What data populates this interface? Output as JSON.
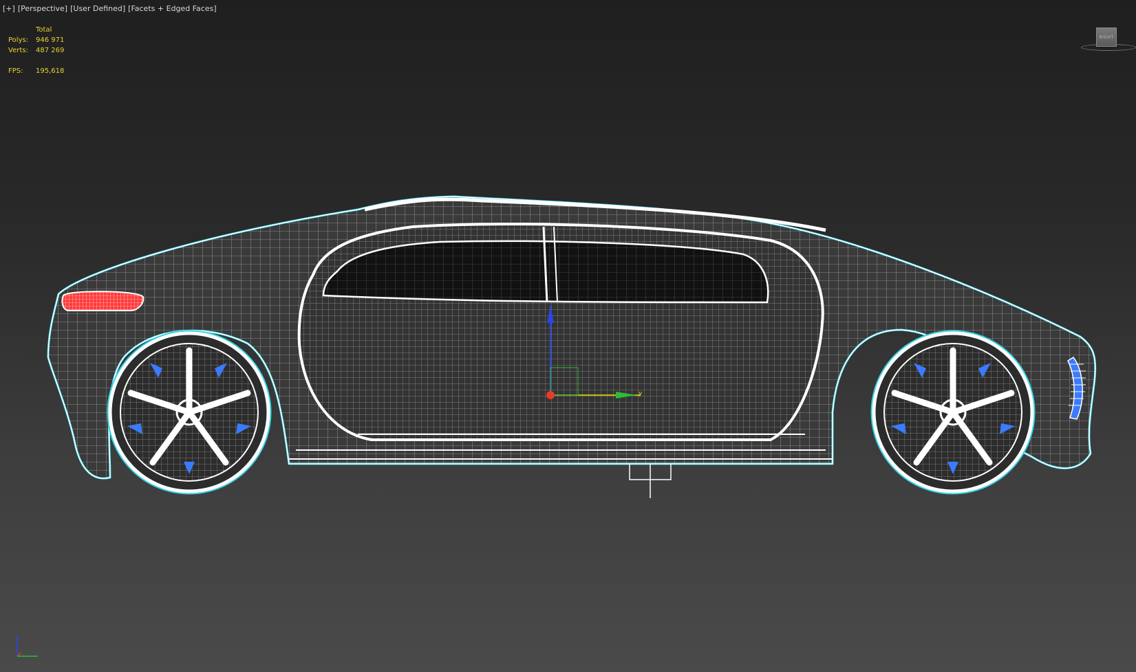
{
  "viewport": {
    "labels": [
      "[+]",
      "[Perspective]",
      "[User Defined]",
      "[Facets + Edged Faces]"
    ]
  },
  "stats": {
    "header": "Total",
    "polys_label": "Polys:",
    "polys_value": "946 971",
    "verts_label": "Verts:",
    "verts_value": "487 269",
    "fps_label": "FPS:",
    "fps_value": "195,618"
  },
  "viewcube": {
    "face_label": "RIGHT"
  },
  "colors": {
    "background_top": "#1f1f1f",
    "background_bottom": "#4a4a4a",
    "stats_text": "#e7d437",
    "label_text": "#d8d8d8",
    "wire": "#ffffff",
    "body_fill": "#3a3a3a",
    "outline": "#39d4e6",
    "tail_light": "#ff3b3b",
    "wheel_accent": "#3a7bff",
    "gizmo_x": "#e83b2a",
    "gizmo_y": "#2dbb3a",
    "gizmo_z": "#2a46e8"
  },
  "scene": {
    "object": "car-wireframe-model",
    "gizmo_axis_y_label": "y"
  }
}
